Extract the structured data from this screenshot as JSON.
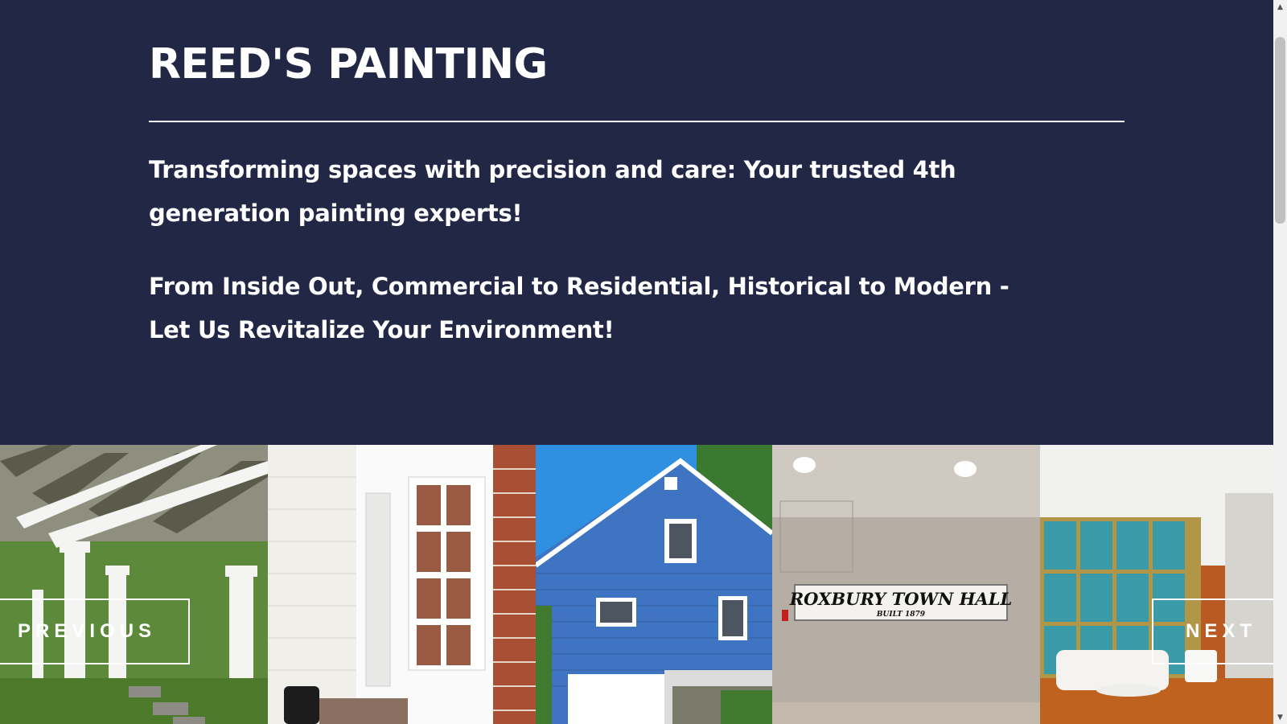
{
  "header": {
    "title": "REED'S PAINTING"
  },
  "hero": {
    "tagline_1": "Transforming spaces with precision and care: Your trusted 4th generation painting experts!",
    "tagline_2": "From Inside Out, Commercial to Residential, Historical to Modern - Let Us Revitalize Your Environment!"
  },
  "gallery": {
    "previous_label": "PREVIOUS",
    "next_label": "NEXT",
    "images": [
      {
        "name": "white-pergola-photo"
      },
      {
        "name": "white-door-brick-photo"
      },
      {
        "name": "blue-house-photo"
      },
      {
        "name": "town-hall-sign-photo",
        "sign_text": "ROXBURY TOWN HALL",
        "sign_subtext": "BUILT   1879"
      },
      {
        "name": "living-room-photo"
      }
    ]
  },
  "colors": {
    "background": "#232746",
    "text": "#ffffff"
  }
}
